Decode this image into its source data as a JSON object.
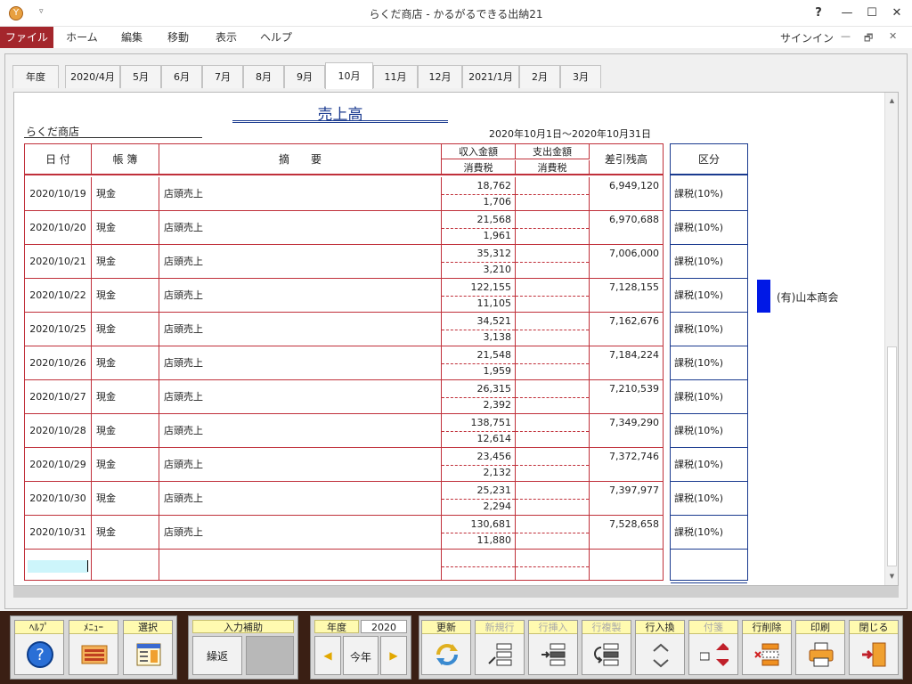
{
  "window": {
    "title": "らくだ商店 - かるがるできる出納21",
    "help_glyph": "?",
    "icon_glyph": "Y",
    "quick_access_glyph": "▿",
    "min_glyph": "—",
    "max_glyph": "☐",
    "close_glyph": "✕"
  },
  "ribbon": {
    "tabs": [
      "ファイル",
      "ホーム",
      "編集",
      "移動",
      "表示",
      "ヘルプ"
    ],
    "signin": "サインイン",
    "min_glyph": "—",
    "restore_glyph": "🗗",
    "close_glyph": "✕"
  },
  "month_tabs": [
    "年度",
    "2020/4月",
    "5月",
    "6月",
    "7月",
    "8月",
    "9月",
    "10月",
    "11月",
    "12月",
    "2021/1月",
    "2月",
    "3月"
  ],
  "active_month": "10月",
  "report": {
    "title": "売上高",
    "company": "らくだ商店",
    "period": "2020年10月1日～2020年10月31日"
  },
  "headers": {
    "date": "日 付",
    "book": "帳 簿",
    "desc": "摘　　要",
    "income": "収入金額",
    "expense": "支出金額",
    "tax": "消費税",
    "balance": "差引残高",
    "category": "区分"
  },
  "rows": [
    {
      "date": "2020/10/19",
      "book": "現金",
      "desc": "店頭売上",
      "amount": "18,762",
      "tax": "1,706",
      "balance": "6,949,120",
      "category": "課税(10%)"
    },
    {
      "date": "2020/10/20",
      "book": "現金",
      "desc": "店頭売上",
      "amount": "21,568",
      "tax": "1,961",
      "balance": "6,970,688",
      "category": "課税(10%)"
    },
    {
      "date": "2020/10/21",
      "book": "現金",
      "desc": "店頭売上",
      "amount": "35,312",
      "tax": "3,210",
      "balance": "7,006,000",
      "category": "課税(10%)"
    },
    {
      "date": "2020/10/22",
      "book": "現金",
      "desc": "店頭売上",
      "amount": "122,155",
      "tax": "11,105",
      "balance": "7,128,155",
      "category": "課税(10%)"
    },
    {
      "date": "2020/10/25",
      "book": "現金",
      "desc": "店頭売上",
      "amount": "34,521",
      "tax": "3,138",
      "balance": "7,162,676",
      "category": "課税(10%)"
    },
    {
      "date": "2020/10/26",
      "book": "現金",
      "desc": "店頭売上",
      "amount": "21,548",
      "tax": "1,959",
      "balance": "7,184,224",
      "category": "課税(10%)"
    },
    {
      "date": "2020/10/27",
      "book": "現金",
      "desc": "店頭売上",
      "amount": "26,315",
      "tax": "2,392",
      "balance": "7,210,539",
      "category": "課税(10%)"
    },
    {
      "date": "2020/10/28",
      "book": "現金",
      "desc": "店頭売上",
      "amount": "138,751",
      "tax": "12,614",
      "balance": "7,349,290",
      "category": "課税(10%)"
    },
    {
      "date": "2020/10/29",
      "book": "現金",
      "desc": "店頭売上",
      "amount": "23,456",
      "tax": "2,132",
      "balance": "7,372,746",
      "category": "課税(10%)"
    },
    {
      "date": "2020/10/30",
      "book": "現金",
      "desc": "店頭売上",
      "amount": "25,231",
      "tax": "2,294",
      "balance": "7,397,977",
      "category": "課税(10%)"
    },
    {
      "date": "2020/10/31",
      "book": "現金",
      "desc": "店頭売上",
      "amount": "130,681",
      "tax": "11,880",
      "balance": "7,528,658",
      "category": "課税(10%)"
    }
  ],
  "vendor": {
    "name": "(有)山本商会",
    "color": "#0018e6"
  },
  "scroll": {
    "up_glyph": "▲",
    "down_glyph": "▼"
  },
  "toolbar": {
    "help": "ﾍﾙﾌﾟ",
    "menu": "ﾒﾆｭｰ",
    "select": "選択",
    "input_assist": "入力補助",
    "repeat": "繰返",
    "year_label": "年度",
    "year_value": "2020",
    "prev_glyph": "◀",
    "this_year": "今年",
    "next_glyph": "▶",
    "refresh": "更新",
    "new_row": "新規行",
    "insert_row": "行挿入",
    "copy_row": "行複製",
    "swap_row": "行入換",
    "sticky": "付箋",
    "delete_row": "行削除",
    "print": "印刷",
    "close": "閉じる"
  },
  "colors": {
    "accent": "#a4262c",
    "grid_red": "#c0303a",
    "grid_blue": "#1a3a8f",
    "button_label_bg": "#fffab0"
  }
}
